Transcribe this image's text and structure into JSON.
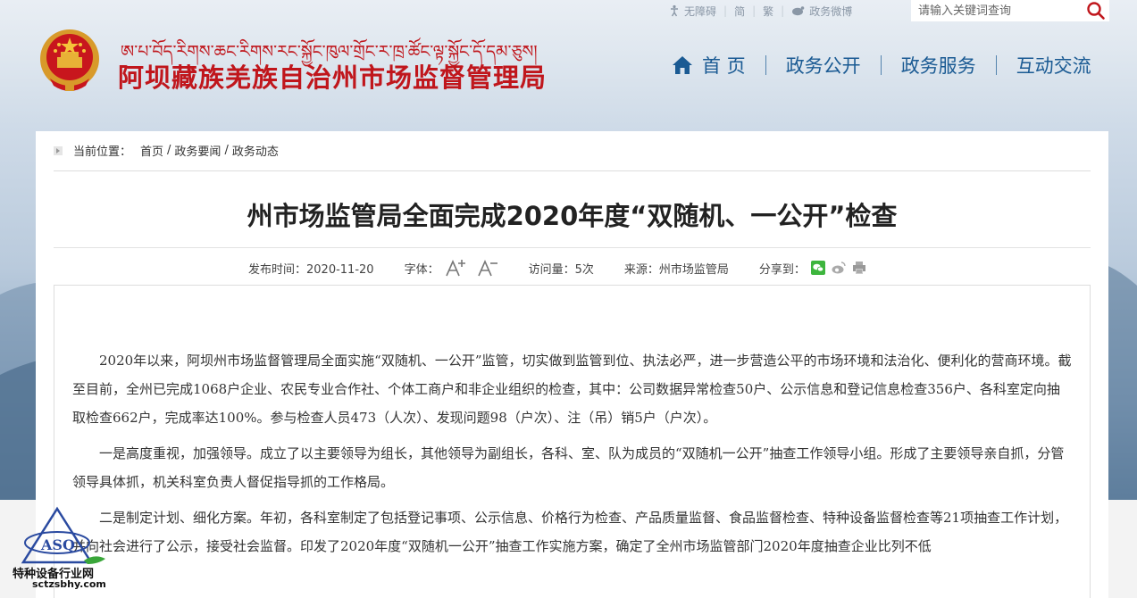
{
  "topbar": {
    "items": [
      "无障碍",
      "简",
      "繁",
      "政务微博"
    ],
    "search_placeholder": "请输入关键词查询"
  },
  "header": {
    "tibetan_name": "ཨ་པ་བོད་རིགས་ཆང་རིགས་རང་སྐྱོང་ཁུལ་གྲོང་ར་ཁྲ་ཚོང་ལྟ་སྐྱོང་དོ་དམ་ཅུས།",
    "site_title": "阿坝藏族羌族自治州市场监督管理局"
  },
  "nav": {
    "items": [
      "首 页",
      "政务公开",
      "政务服务",
      "互动交流"
    ]
  },
  "breadcrumb": {
    "label": "当前位置：",
    "items": [
      "首页",
      "政务要闻",
      "政务动态"
    ],
    "separator": "/"
  },
  "article": {
    "title": "州市场监管局全面完成2020年度“双随机、一公开”检查",
    "meta": {
      "publish": "发布时间：2020-11-20",
      "font_label": "字体：",
      "font_increase": "A+",
      "font_decrease": "A−",
      "views": "访问量：5次",
      "source": "来源：州市场监管局",
      "share_label": "分享到："
    },
    "paragraphs": [
      "2020年以来，阿坝州市场监督管理局全面实施“双随机、一公开”监管，切实做到监管到位、执法必严，进一步营造公平的市场环境和法治化、便利化的营商环境。截至目前，全州已完成1068户企业、农民专业合作社、个体工商户和非企业组织的检查，其中：公司数据异常检查50户、公示信息和登记信息检查356户、各科室定向抽取检查662户，完成率达100%。参与检查人员473（人次）、发现问题98（户次）、注（吊）销5户（户次）。",
      "一是高度重视，加强领导。成立了以主要领导为组长，其他领导为副组长，各科、室、队为成员的“双随机一公开”抽查工作领导小组。形成了主要领导亲自抓，分管领导具体抓，机关科室负责人督促指导抓的工作格局。",
      "二是制定计划、细化方案。年初，各科室制定了包括登记事项、公示信息、价格行为检查、产品质量监督、食品监督检查、特种设备监督检查等21项抽查工作计划，并向社会进行了公示，接受社会监督。印发了2020年度“双随机一公开”抽查工作实施方案，确定了全州市场监管部门2020年度抽查企业比列不低"
    ]
  },
  "watermark": {
    "letters": "ASQ",
    "name": "特种设备行业网",
    "url": "sctzsbhy.com"
  },
  "colors": {
    "brand_red": "#c0161c",
    "nav_blue": "#1a5a93"
  }
}
